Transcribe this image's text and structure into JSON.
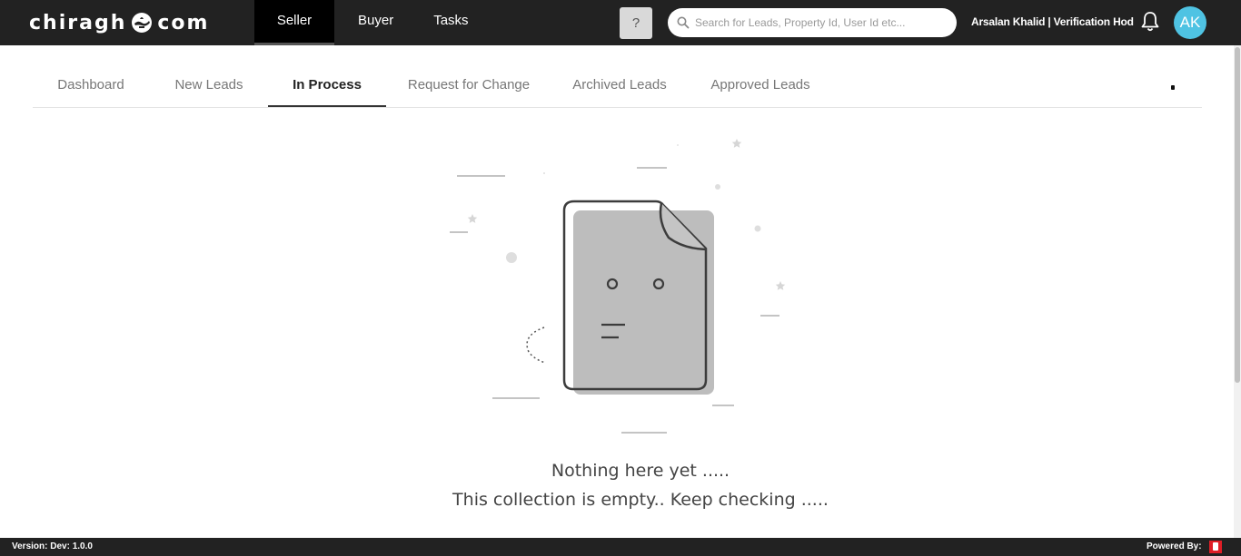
{
  "header": {
    "logo_left": "chiragh",
    "logo_right": "com",
    "logo_icon": "genie-lamp-icon",
    "nav": [
      {
        "label": "Seller",
        "active": true
      },
      {
        "label": "Buyer",
        "active": false
      },
      {
        "label": "Tasks",
        "active": false
      }
    ],
    "help_label": "?",
    "search_placeholder": "Search for Leads, Property Id, User Id etc...",
    "user_label": "Arsalan Khalid | Verification Hod",
    "avatar_initials": "AK",
    "avatar_color": "#4fc3e3"
  },
  "tabs": [
    {
      "label": "Dashboard",
      "active": false
    },
    {
      "label": "New Leads",
      "active": false
    },
    {
      "label": "In Process",
      "active": true
    },
    {
      "label": "Request for Change",
      "active": false
    },
    {
      "label": "Archived Leads",
      "active": false
    },
    {
      "label": "Approved Leads",
      "active": false
    }
  ],
  "empty_state": {
    "title": "Nothing here yet .....",
    "subtitle": "This collection is empty.. Keep checking .....",
    "icon": "empty-document-icon"
  },
  "footer": {
    "version": "Version: Dev: 1.0.0",
    "powered_by": "Powered By:"
  },
  "colors": {
    "topbar": "#222222",
    "active_nav": "#000000",
    "text_muted": "#777777"
  }
}
